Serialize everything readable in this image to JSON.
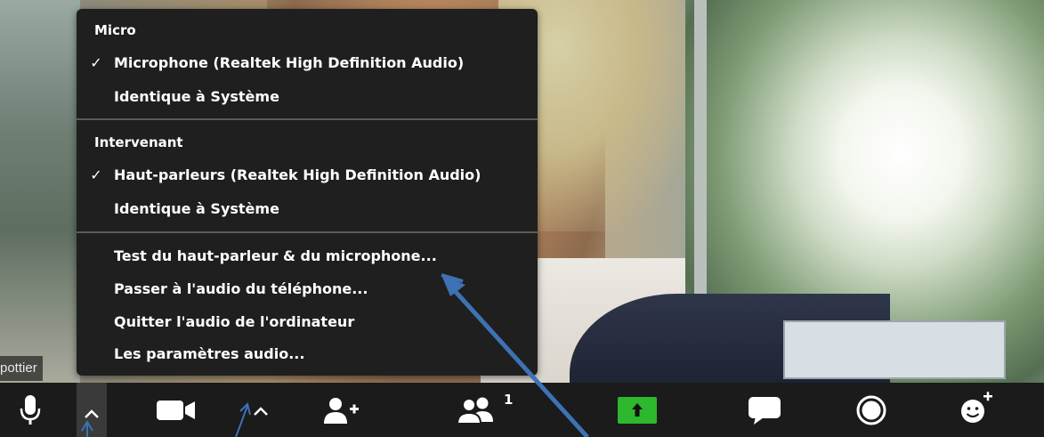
{
  "participant": {
    "name_tag": "pottier"
  },
  "audio_menu": {
    "micro_header": "Micro",
    "micro_items": [
      {
        "label": "Microphone (Realtek High Definition Audio)",
        "checked": true
      },
      {
        "label": "Identique à Système",
        "checked": false
      }
    ],
    "speaker_header": "Intervenant",
    "speaker_items": [
      {
        "label": "Haut-parleurs (Realtek High Definition Audio)",
        "checked": true
      },
      {
        "label": "Identique à Système",
        "checked": false
      }
    ],
    "actions": [
      {
        "label": "Test du haut-parleur & du microphone..."
      },
      {
        "label": "Passer à l'audio du téléphone..."
      },
      {
        "label": "Quitter l'audio de l'ordinateur"
      },
      {
        "label": "Les paramètres audio..."
      }
    ],
    "check_glyph": "✓"
  },
  "toolbar": {
    "participants_count": "1",
    "icons": [
      "microphone-icon",
      "chevron-up-icon",
      "video-camera-icon",
      "chevron-up-icon",
      "invite-icon",
      "participants-icon",
      "share-screen-icon",
      "chat-icon",
      "record-icon",
      "reactions-icon"
    ],
    "share_color": "#2db82d"
  },
  "annotation": {
    "arrow_color": "#3d72b4"
  }
}
